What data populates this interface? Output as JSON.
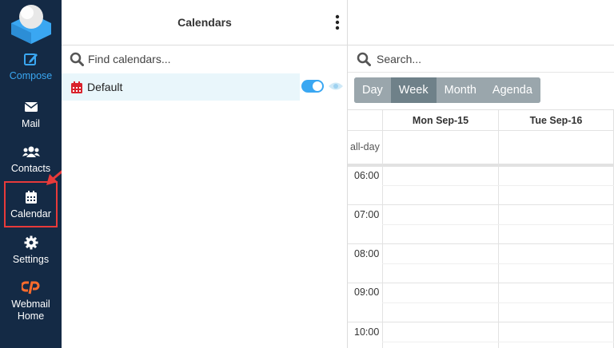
{
  "sidebar": {
    "items": [
      {
        "key": "compose",
        "label": "Compose",
        "icon": "compose-icon"
      },
      {
        "key": "mail",
        "label": "Mail",
        "icon": "mail-icon"
      },
      {
        "key": "contacts",
        "label": "Contacts",
        "icon": "contacts-icon"
      },
      {
        "key": "calendar",
        "label": "Calendar",
        "icon": "calendar-icon"
      },
      {
        "key": "settings",
        "label": "Settings",
        "icon": "gear-icon"
      },
      {
        "key": "webmail",
        "label": "Webmail Home",
        "icon": "cpanel-icon"
      }
    ],
    "active": "calendar",
    "highlight_color": "#e83a3a",
    "compose_color": "#3aa7f2",
    "background": "#142a45"
  },
  "calendars_panel": {
    "title": "Calendars",
    "find_placeholder": "Find calendars...",
    "calendars": [
      {
        "name": "Default",
        "color": "#d9232d",
        "enabled": true
      }
    ]
  },
  "main": {
    "search_placeholder": "Search...",
    "views": [
      "Day",
      "Week",
      "Month",
      "Agenda"
    ],
    "active_view": "Week",
    "days": [
      "Mon Sep-15",
      "Tue Sep-16"
    ],
    "allday_label": "all-day",
    "hours": [
      "06:00",
      "07:00",
      "08:00",
      "09:00",
      "10:00"
    ]
  },
  "colors": {
    "accent": "#3aa7f2",
    "view_inactive": "#9aa6ac",
    "view_active": "#6f8189"
  }
}
